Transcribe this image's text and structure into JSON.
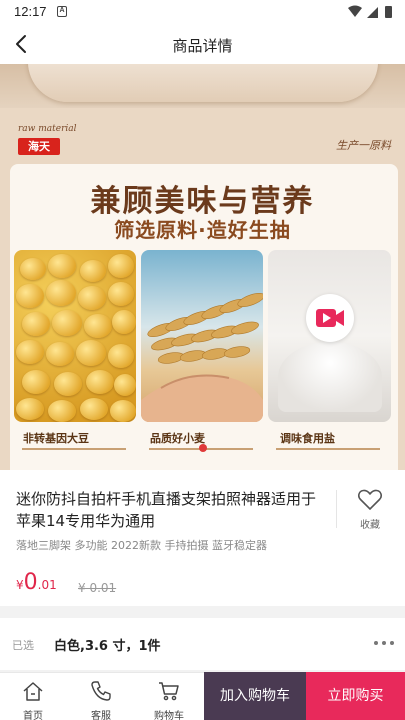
{
  "status_bar": {
    "time": "12:17",
    "notification_glyph": "A",
    "icons": [
      "wifi-icon",
      "signal-icon",
      "battery-icon"
    ]
  },
  "nav": {
    "title": "商品详情",
    "back_icon": "chevron-left-icon"
  },
  "banner": {
    "raw_material": "raw material",
    "brand_logo": "海天",
    "production_label": "生产一原料",
    "headline": "兼顾美味与营养",
    "subheadline": "筛选原料·造好生抽",
    "tiles": [
      {
        "label": "非转基因大豆"
      },
      {
        "label": "品质好小麦"
      },
      {
        "label": "调味食用盐"
      }
    ],
    "video_icon": "video-camera-icon"
  },
  "product": {
    "title": "迷你防抖自拍杆手机直播支架拍照神器适用于苹果14专用华为通用",
    "subtitle": "落地三脚架 多功能 2022新款 手持拍摄 蓝牙稳定器",
    "price_symbol": "¥",
    "price_int": "0",
    "price_dec": ".01",
    "original_price": "¥ 0.01",
    "favorite_label": "收藏"
  },
  "selection": {
    "label": "已选",
    "value": "白色,3.6 寸，1件"
  },
  "bottom_bar": {
    "items": [
      {
        "label": "首页"
      },
      {
        "label": "客服"
      },
      {
        "label": "购物车"
      }
    ],
    "add_to_cart": "加入购物车",
    "buy_now": "立即购买"
  },
  "colors": {
    "accent": "#e8295b",
    "cart_button": "#4a3a52",
    "price": "#e0264a"
  }
}
